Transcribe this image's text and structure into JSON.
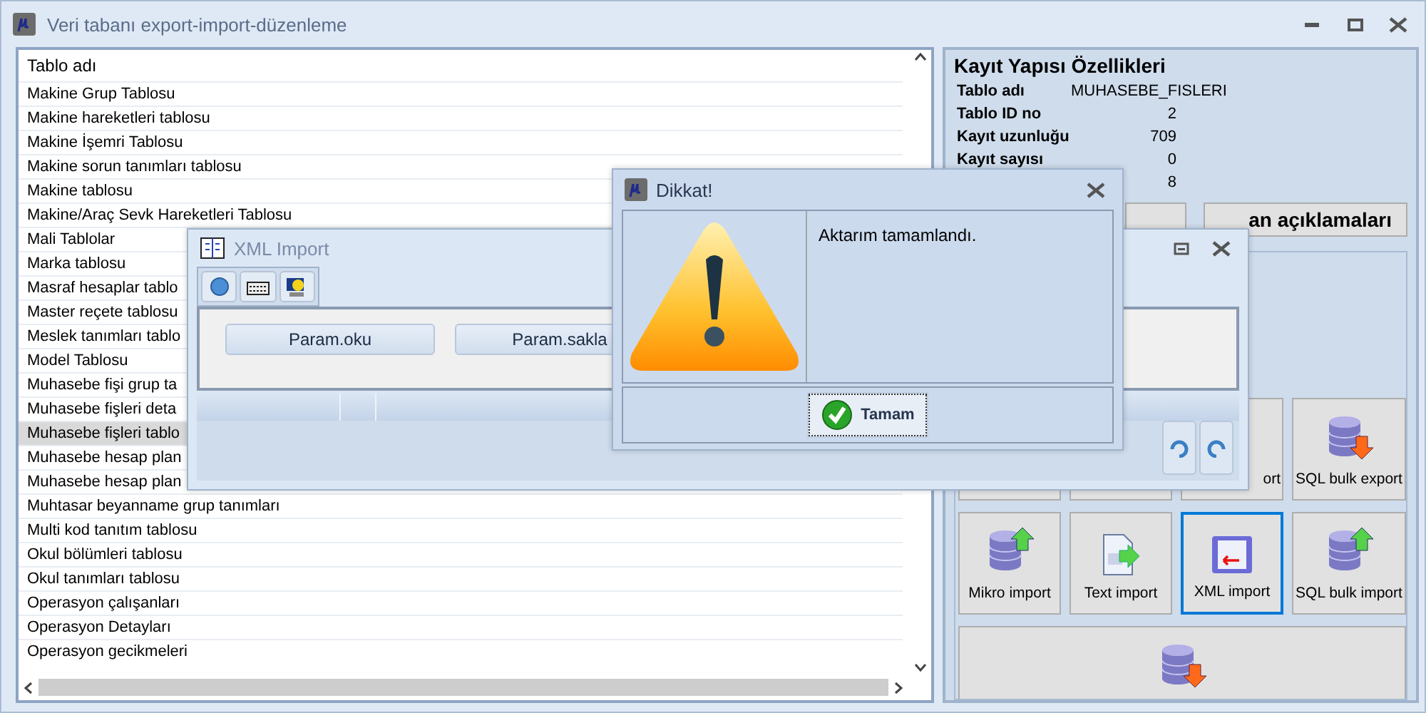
{
  "window": {
    "title": "Veri tabanı export-import-düzenleme"
  },
  "table": {
    "columns": [
      "Tablo adı"
    ],
    "rows": [
      {
        "name": "Makine Grup Tablosu",
        "selected": false
      },
      {
        "name": "Makine hareketleri tablosu",
        "selected": false
      },
      {
        "name": "Makine İşemri Tablosu",
        "selected": false
      },
      {
        "name": "Makine sorun tanımları tablosu",
        "selected": false
      },
      {
        "name": "Makine tablosu",
        "selected": false
      },
      {
        "name": "Makine/Araç Sevk Hareketleri Tablosu",
        "selected": false
      },
      {
        "name": "Mali Tablolar",
        "selected": false
      },
      {
        "name": "Marka tablosu",
        "selected": false
      },
      {
        "name": "Masraf hesaplar tablo",
        "selected": false
      },
      {
        "name": "Master reçete tablosu",
        "selected": false
      },
      {
        "name": "Meslek tanımları tablo",
        "selected": false
      },
      {
        "name": "Model Tablosu",
        "selected": false
      },
      {
        "name": "Muhasebe fişi grup ta",
        "selected": false
      },
      {
        "name": "Muhasebe fişleri deta",
        "selected": false
      },
      {
        "name": "Muhasebe fişleri tablo",
        "selected": true
      },
      {
        "name": "Muhasebe hesap plan",
        "selected": false
      },
      {
        "name": "Muhasebe hesap plan",
        "selected": false
      },
      {
        "name": "Muhtasar beyanname grup tanımları",
        "selected": false
      },
      {
        "name": "Multi kod tanıtım tablosu",
        "selected": false
      },
      {
        "name": "Okul bölümleri tablosu",
        "selected": false
      },
      {
        "name": "Okul tanımları tablosu",
        "selected": false
      },
      {
        "name": "Operasyon çalışanları",
        "selected": false
      },
      {
        "name": "Operasyon Detayları",
        "selected": false
      },
      {
        "name": "Operasyon gecikmeleri",
        "selected": false
      }
    ]
  },
  "properties_panel": {
    "title": "Kayıt Yapısı Özellikleri",
    "fields": [
      {
        "kind": "text",
        "label": "Tablo adı",
        "value": "MUHASEBE_FISLERI"
      },
      {
        "kind": "number",
        "label": "Tablo ID no",
        "value": "2"
      },
      {
        "kind": "number",
        "label": "Kayıt uzunluğu",
        "value": "709"
      },
      {
        "kind": "number",
        "label": "Kayıt sayısı",
        "value": "0"
      },
      {
        "kind": "number",
        "value": "8"
      }
    ]
  },
  "action_buttons": [
    {
      "kind": "blank"
    },
    {
      "kind": "clipped",
      "label": "an açıklamaları"
    }
  ],
  "operation_buttons": [
    {
      "kind": "blank",
      "focused": false
    },
    {
      "kind": "blank",
      "focused": false
    },
    {
      "kind": "clipped",
      "label": "ort",
      "focused": false
    },
    {
      "kind": "sql_export",
      "label": "SQL bulk export",
      "focused": false
    },
    {
      "kind": "db_import",
      "label": "Mikro import",
      "focused": false
    },
    {
      "kind": "text_import",
      "label": "Text import",
      "focused": false
    },
    {
      "kind": "xml_import",
      "label": "XML import",
      "focused": true
    },
    {
      "kind": "sql_import",
      "label": "SQL bulk import",
      "focused": false
    },
    {
      "kind": "db_export",
      "focused": false
    }
  ],
  "xml_import_dialog": {
    "title": "XML Import",
    "buttons": [
      "Param.oku",
      "Param.sakla"
    ]
  },
  "alert_dialog": {
    "title": "Dikkat!",
    "message": "Aktarım tamamlandı.",
    "button": "Tamam"
  }
}
